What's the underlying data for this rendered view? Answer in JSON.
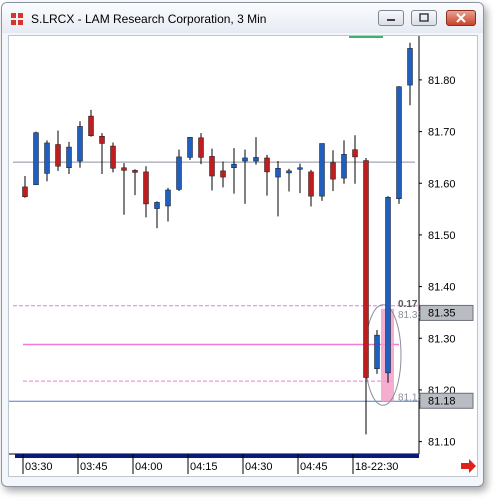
{
  "window": {
    "title": "S.LRCX - LAM Research Corporation, 3 Min",
    "buttons": [
      "minimize",
      "maximize",
      "close"
    ]
  },
  "chart_data": {
    "type": "candlestick",
    "symbol": "S.LRCX",
    "interval": "3 Min",
    "y_ticks": [
      "81.80",
      "81.70",
      "81.60",
      "81.50",
      "81.40",
      "81.30",
      "81.20",
      "81.10"
    ],
    "y_range": [
      81.076,
      81.885
    ],
    "x_labels": [
      "03:30",
      "03:45",
      "04:00",
      "04:15",
      "04:30",
      "04:45",
      "18-22:30"
    ],
    "current_price_label": "81.35",
    "level_label": "81.18",
    "level_annotation": "81.18",
    "overlay_labels": [
      "0.17",
      "81.35"
    ],
    "reference_price": 81.641,
    "reference_price_lines": [
      81.363,
      81.288,
      81.217,
      81.178
    ],
    "colors": {
      "up": "#1f5fbf",
      "down": "#c01e1e",
      "pink": "#f07ad8",
      "grid": "#7a8a9a",
      "highlight": "#f4a0c8"
    },
    "candles": [
      {
        "o": 81.593,
        "h": 81.614,
        "l": 81.572,
        "c": 81.574
      },
      {
        "o": 81.597,
        "h": 81.7,
        "l": 81.597,
        "c": 81.698
      },
      {
        "o": 81.619,
        "h": 81.683,
        "l": 81.604,
        "c": 81.678
      },
      {
        "o": 81.675,
        "h": 81.702,
        "l": 81.624,
        "c": 81.633
      },
      {
        "o": 81.63,
        "h": 81.68,
        "l": 81.618,
        "c": 81.67
      },
      {
        "o": 81.643,
        "h": 81.72,
        "l": 81.63,
        "c": 81.71
      },
      {
        "o": 81.73,
        "h": 81.742,
        "l": 81.69,
        "c": 81.692
      },
      {
        "o": 81.691,
        "h": 81.697,
        "l": 81.618,
        "c": 81.677
      },
      {
        "o": 81.672,
        "h": 81.679,
        "l": 81.621,
        "c": 81.629
      },
      {
        "o": 81.63,
        "h": 81.639,
        "l": 81.539,
        "c": 81.625
      },
      {
        "o": 81.625,
        "h": 81.627,
        "l": 81.577,
        "c": 81.621
      },
      {
        "o": 81.622,
        "h": 81.633,
        "l": 81.534,
        "c": 81.56
      },
      {
        "o": 81.551,
        "h": 81.565,
        "l": 81.513,
        "c": 81.563
      },
      {
        "o": 81.556,
        "h": 81.591,
        "l": 81.526,
        "c": 81.587
      },
      {
        "o": 81.588,
        "h": 81.665,
        "l": 81.585,
        "c": 81.651
      },
      {
        "o": 81.65,
        "h": 81.689,
        "l": 81.645,
        "c": 81.689
      },
      {
        "o": 81.688,
        "h": 81.697,
        "l": 81.637,
        "c": 81.65
      },
      {
        "o": 81.652,
        "h": 81.667,
        "l": 81.586,
        "c": 81.614
      },
      {
        "o": 81.624,
        "h": 81.642,
        "l": 81.592,
        "c": 81.612
      },
      {
        "o": 81.63,
        "h": 81.668,
        "l": 81.58,
        "c": 81.637
      },
      {
        "o": 81.643,
        "h": 81.665,
        "l": 81.56,
        "c": 81.649
      },
      {
        "o": 81.643,
        "h": 81.689,
        "l": 81.636,
        "c": 81.65
      },
      {
        "o": 81.649,
        "h": 81.655,
        "l": 81.576,
        "c": 81.622
      },
      {
        "o": 81.612,
        "h": 81.643,
        "l": 81.536,
        "c": 81.629
      },
      {
        "o": 81.62,
        "h": 81.628,
        "l": 81.584,
        "c": 81.624
      },
      {
        "o": 81.627,
        "h": 81.638,
        "l": 81.581,
        "c": 81.63
      },
      {
        "o": 81.622,
        "h": 81.626,
        "l": 81.555,
        "c": 81.575
      },
      {
        "o": 81.575,
        "h": 81.677,
        "l": 81.566,
        "c": 81.677
      },
      {
        "o": 81.64,
        "h": 81.664,
        "l": 81.585,
        "c": 81.608
      },
      {
        "o": 81.61,
        "h": 81.683,
        "l": 81.599,
        "c": 81.656
      },
      {
        "o": 81.665,
        "h": 81.693,
        "l": 81.599,
        "c": 81.651
      },
      {
        "o": 81.644,
        "h": 81.649,
        "l": 81.114,
        "c": 81.224
      },
      {
        "o": 81.241,
        "h": 81.316,
        "l": 81.231,
        "c": 81.306
      },
      {
        "o": 81.233,
        "h": 81.575,
        "l": 81.214,
        "c": 81.573
      },
      {
        "o": 81.57,
        "h": 81.788,
        "l": 81.56,
        "c": 81.787
      },
      {
        "o": 81.79,
        "h": 81.872,
        "l": 81.751,
        "c": 81.861
      }
    ]
  }
}
